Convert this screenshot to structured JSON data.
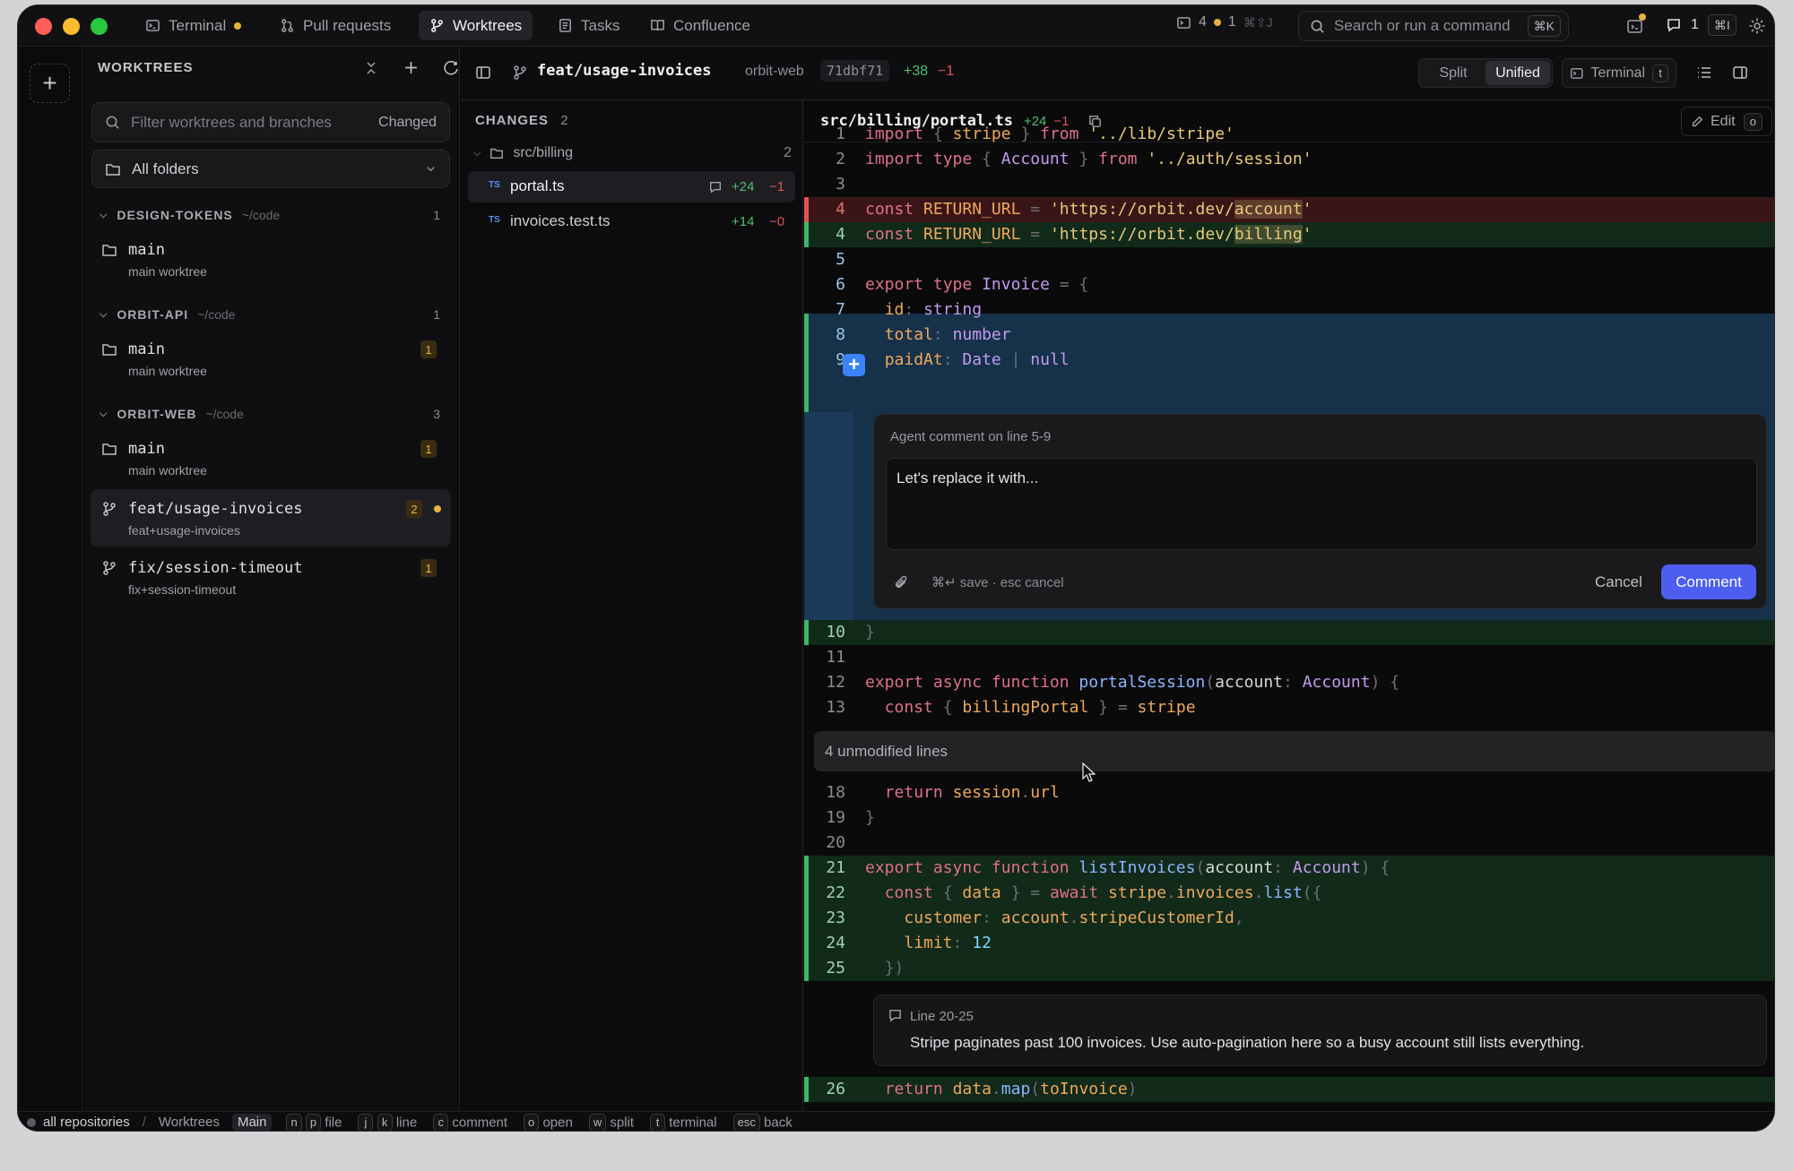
{
  "tabs": [
    {
      "label": "Terminal",
      "icon": "terminal-icon",
      "dot": true
    },
    {
      "label": "Pull requests",
      "icon": "pull-request-icon"
    },
    {
      "label": "Worktrees",
      "icon": "branch-icon",
      "active": true
    },
    {
      "label": "Tasks",
      "icon": "tasks-icon"
    },
    {
      "label": "Confluence",
      "icon": "book-icon"
    }
  ],
  "titlebar": {
    "tasks_count": "4",
    "tasks_warn": "1",
    "tasks_shortcut": "⌘⇧J",
    "search_placeholder": "Search or run a command",
    "search_shortcut": "⌘K",
    "comments_count": "1",
    "comments_shortcut": "⌘I"
  },
  "worktrees": {
    "title": "WORKTREES",
    "filter_placeholder": "Filter worktrees and branches",
    "filter_changed": "Changed",
    "folders": "All folders",
    "groups": [
      {
        "name": "DESIGN-TOKENS",
        "path": "~/code",
        "count": "1"
      },
      {
        "name": "ORBIT-API",
        "path": "~/code",
        "count": "1"
      },
      {
        "name": "ORBIT-WEB",
        "path": "~/code",
        "count": "3"
      }
    ],
    "items": [
      {
        "name": "main",
        "sub": "main worktree"
      },
      {
        "name": "main",
        "sub": "main worktree",
        "badge": "1"
      },
      {
        "name": "main",
        "sub": "main worktree",
        "badge": "1"
      },
      {
        "name": "feat/usage-invoices",
        "sub": "feat+usage-invoices",
        "badge": "2"
      },
      {
        "name": "fix/session-timeout",
        "sub": "fix+session-timeout",
        "badge": "1"
      }
    ]
  },
  "branch_bar": {
    "branch": "feat/usage-invoices",
    "repo": "orbit-web",
    "sha": "71dbf71",
    "additions": "+38",
    "deletions": "−1",
    "split": "Split",
    "unified": "Unified",
    "terminal": "Terminal",
    "terminal_key": "t"
  },
  "changes": {
    "title": "CHANGES",
    "count": "2",
    "folder": "src/billing",
    "folder_count": "2",
    "files": [
      {
        "type": "TS",
        "name": "portal.ts",
        "add": "+24",
        "del": "−1"
      },
      {
        "type": "TS",
        "name": "invoices.test.ts",
        "add": "+14",
        "del": "−0"
      }
    ]
  },
  "diff": {
    "path": "src/billing/portal.ts",
    "add": "+24",
    "del": "−1",
    "edit": "Edit",
    "edit_key": "o",
    "line_numbers": [
      "1",
      "2",
      "3",
      "4",
      "4",
      "5",
      "6",
      "7",
      "8",
      "9",
      "10",
      "11",
      "12",
      "13",
      "18",
      "19",
      "20",
      "21",
      "22",
      "23",
      "24",
      "25",
      "26"
    ],
    "unmodified": "4 unmodified lines",
    "comment": {
      "title": "Agent comment on line 5-9",
      "text": "Let's replace it with...",
      "hint": "⌘↵ save · esc cancel",
      "cancel": "Cancel",
      "submit": "Comment"
    },
    "note": {
      "range": "Line 20-25",
      "text": "Stripe paginates past 100 invoices. Use auto-pagination here so a busy account still lists everything."
    }
  },
  "statusbar": {
    "scope": "all repositories",
    "sep": "/",
    "view": "Worktrees",
    "mode": "Main",
    "hints": [
      {
        "keys": [
          "n",
          "p"
        ],
        "label": "file"
      },
      {
        "keys": [
          "j",
          "k"
        ],
        "label": "line"
      },
      {
        "keys": [
          "c"
        ],
        "label": "comment"
      },
      {
        "keys": [
          "o"
        ],
        "label": "open"
      },
      {
        "keys": [
          "w"
        ],
        "label": "split"
      },
      {
        "keys": [
          "t"
        ],
        "label": "terminal"
      },
      {
        "keys": [
          "esc"
        ],
        "label": "back"
      }
    ]
  }
}
